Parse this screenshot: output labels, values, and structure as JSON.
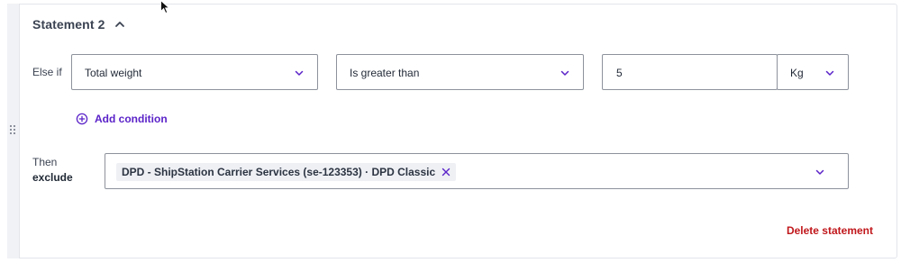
{
  "statement": {
    "title": "Statement 2"
  },
  "condition": {
    "prefix": "Else if",
    "field": "Total weight",
    "operator": "Is greater than",
    "value": "5",
    "unit": "Kg"
  },
  "add_condition": {
    "label": "Add condition",
    "icon": "plus-circle-icon"
  },
  "then": {
    "line1": "Then",
    "line2": "exclude",
    "selected": "DPD - ShipStation Carrier Services (se-123353) · DPD Classic"
  },
  "delete_label": "Delete statement",
  "colors": {
    "accent": "#5a22c8",
    "danger": "#c0171b",
    "text": "#232b38",
    "border": "#8d929c"
  }
}
